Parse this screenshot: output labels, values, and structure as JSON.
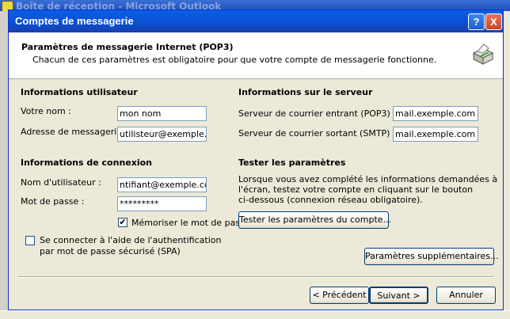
{
  "background": {
    "window_title": "Boîte de réception - Microsoft Outlook"
  },
  "dialog": {
    "title": "Comptes de messagerie",
    "help_btn": "?",
    "close_btn": "X",
    "header_title": "Paramètres de messagerie Internet (POP3)",
    "header_desc": "Chacun de ces paramètres est obligatoire pour que votre compte de messagerie fonctionne."
  },
  "user": {
    "section": "Informations utilisateur",
    "name_label": "Votre nom :",
    "name_value": "mon nom",
    "email_label": "Adresse de messagerie :",
    "email_value": "utilisteur@exemple.com"
  },
  "logon": {
    "section": "Informations de connexion",
    "username_label": "Nom d'utilisateur :",
    "username_value": "ntifiant@exemple.com",
    "password_label": "Mot de passe :",
    "password_value": "*********",
    "remember_label": "Mémoriser le mot de passe",
    "remember_checked": "✔",
    "spa_label": "Se connecter à l'aide de l'authentification",
    "spa_label2": "par mot de passe sécurisé (SPA)"
  },
  "server": {
    "section": "Informations sur le serveur",
    "incoming_label": "Serveur de courrier entrant (POP3) :",
    "incoming_value": "mail.exemple.com",
    "outgoing_label": "Serveur de courrier sortant (SMTP) :",
    "outgoing_value": "mail.exemple.com"
  },
  "test": {
    "section": "Tester les paramètres",
    "desc1": "Lorsque vous avez complété les informations demandées à",
    "desc2": "l'écran, testez votre compte en cliquant sur le bouton",
    "desc3": "ci-dessous (connexion réseau obligatoire).",
    "test_button": "Tester les paramètres du compte...",
    "more_button": "Paramètres supplémentaires..."
  },
  "footer": {
    "back": "< Précédent",
    "next": "Suivant >",
    "cancel": "Annuler"
  }
}
